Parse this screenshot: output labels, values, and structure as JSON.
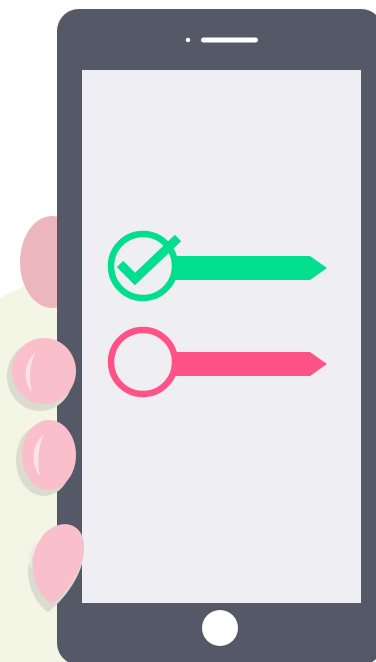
{
  "colors": {
    "background": "#ffffff",
    "hand_backdrop": "#f3f6e4",
    "phone_body": "#555866",
    "phone_screen": "#efeff3",
    "speaker": "#ffffff",
    "home_button": "#ffffff",
    "finger_back": "#ecb6be",
    "finger_front": "#f9bfcb",
    "finger_shadow": "#d9dccf",
    "finger_highlight": "#fde3e8",
    "checked_item": "#00de8e",
    "unchecked_item": "#ff5287"
  },
  "icons": {
    "checked": "checkmark-circle-icon",
    "unchecked": "empty-circle-icon",
    "home": "home-button-icon",
    "speaker": "speaker-icon"
  },
  "checklist": [
    {
      "state": "checked",
      "color_key": "checked_item"
    },
    {
      "state": "unchecked",
      "color_key": "unchecked_item"
    }
  ]
}
